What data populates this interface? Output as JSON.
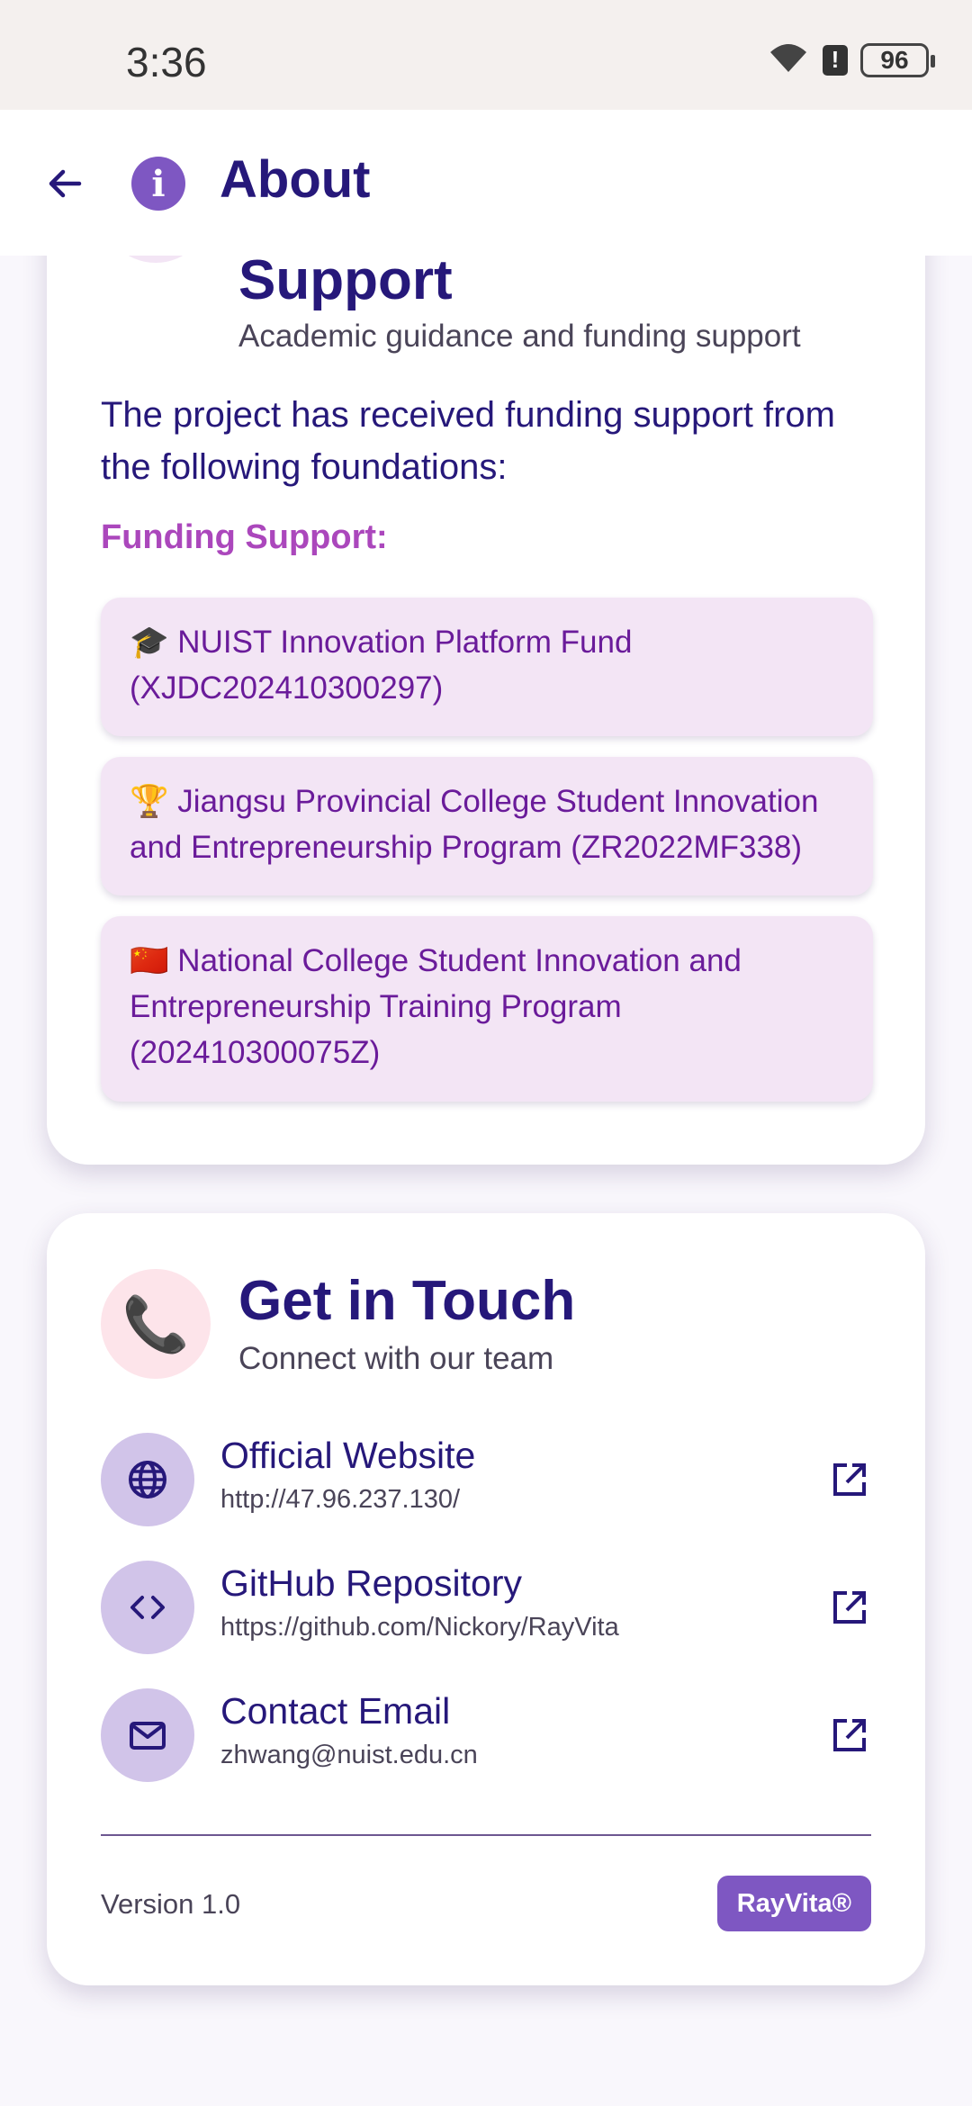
{
  "status_bar": {
    "time": "3:36",
    "battery": "96",
    "icons": [
      "wifi-icon",
      "alert-icon",
      "battery-icon"
    ]
  },
  "app_bar": {
    "title": "About",
    "back_icon": "arrow-left-icon",
    "info_icon": "info-icon",
    "info_glyph": "i"
  },
  "support_card": {
    "emoji": "🏛️",
    "title": "Support",
    "subtitle": "Academic guidance and funding support",
    "intro": "The project has received funding support from the following foundations:",
    "funding_label": "Funding Support:",
    "funds": [
      {
        "text": "🎓 NUIST Innovation Platform Fund (XJDC202410300297)"
      },
      {
        "text": "🏆 Jiangsu Provincial College Student Innovation and Entrepreneurship Program (ZR2022MF338)"
      },
      {
        "text": "🇨🇳 National College Student Innovation and Entrepreneurship Training Program (202410300075Z)"
      }
    ]
  },
  "contact_card": {
    "emoji": "📞",
    "title": "Get in Touch",
    "subtitle": "Connect with our team",
    "items": [
      {
        "icon": "globe-icon",
        "title": "Official Website",
        "value": "http://47.96.237.130/"
      },
      {
        "icon": "code-icon",
        "title": "GitHub Repository",
        "value": "https://github.com/Nickory/RayVita"
      },
      {
        "icon": "mail-icon",
        "title": "Contact Email",
        "value": "zhwang@nuist.edu.cn"
      }
    ],
    "version": "Version 1.0",
    "brand": "RayVita®"
  },
  "colors": {
    "primary": "#26187a",
    "accent": "#7e57c2",
    "funding_label": "#ab47bc",
    "fund_bg": "#f3e5f5",
    "fund_text": "#6a1b9a",
    "contact_icon_bg": "#d1c4e9"
  }
}
